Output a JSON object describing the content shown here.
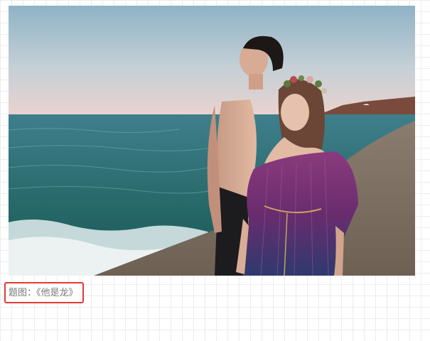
{
  "photo": {
    "icon": "photo-image",
    "subject": "couple-on-beach"
  },
  "caption": {
    "text": "题图：《他是龙》",
    "color": "#7a7a7a",
    "highlight_color": "#e53935"
  }
}
